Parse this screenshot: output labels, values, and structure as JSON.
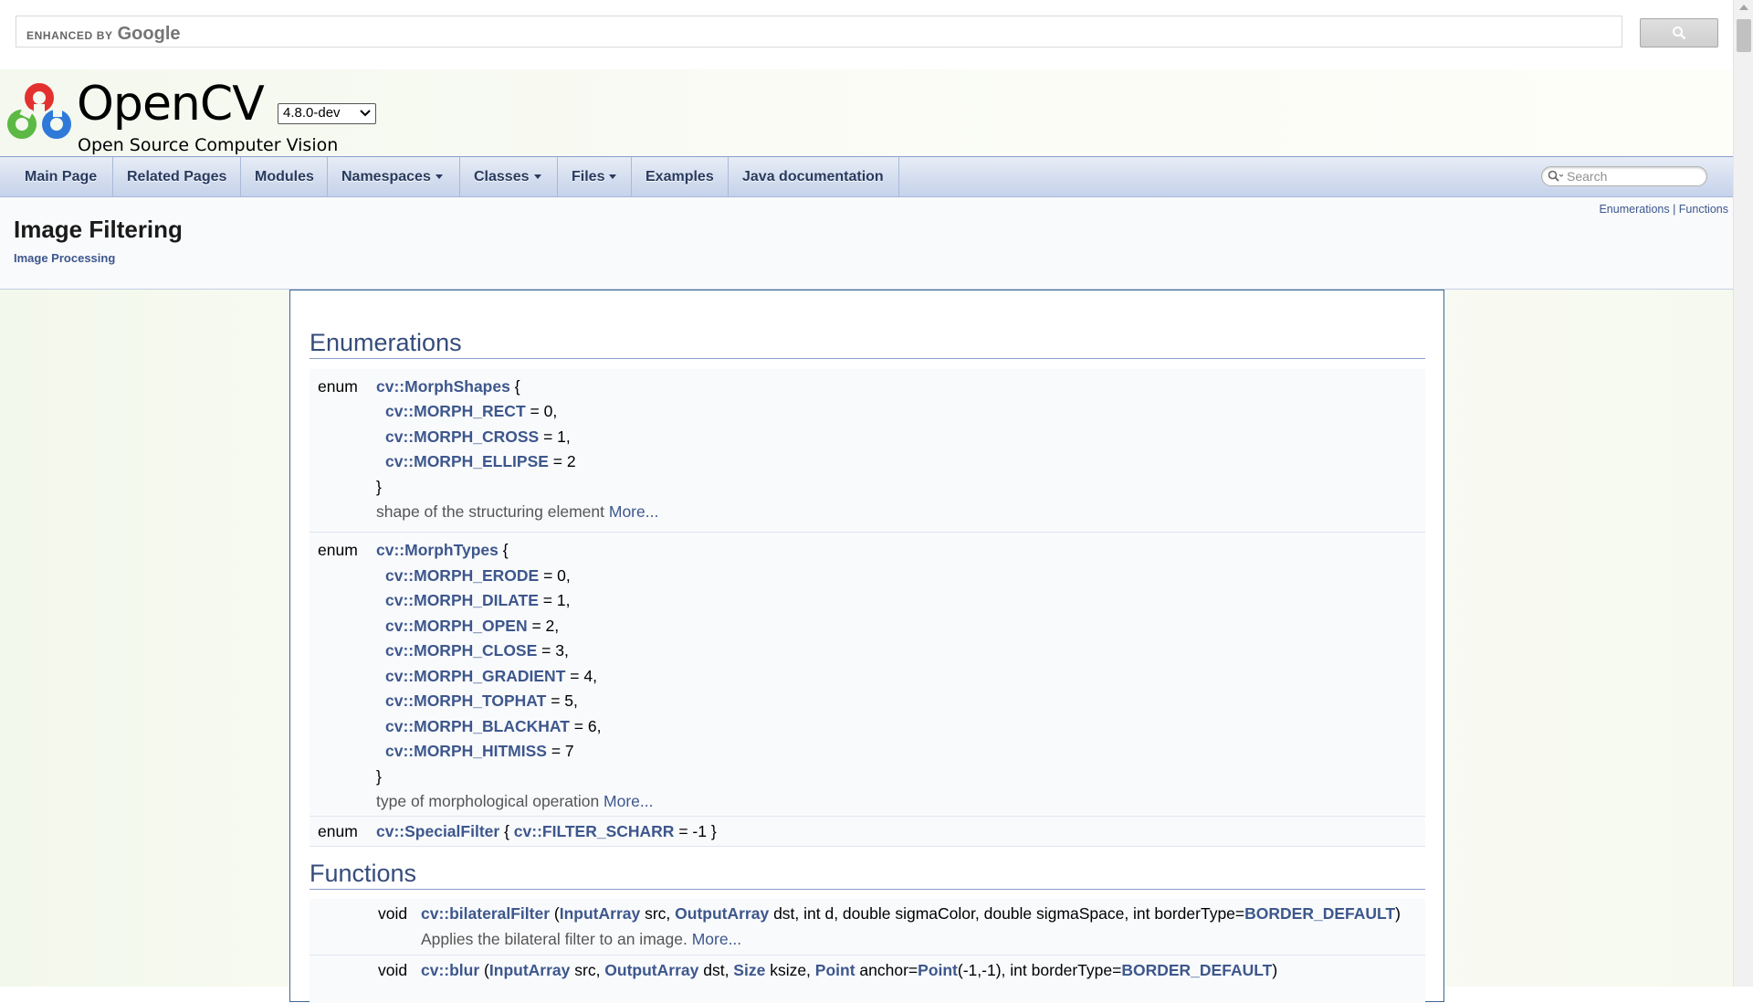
{
  "google_search": {
    "enhanced_by": "ENHANCED BY",
    "google": "Google"
  },
  "header": {
    "project_name": "OpenCV",
    "project_brief": "Open Source Computer Vision",
    "version": "4.8.0-dev"
  },
  "nav": {
    "items": [
      {
        "label": "Main Page",
        "dropdown": false
      },
      {
        "label": "Related Pages",
        "dropdown": false
      },
      {
        "label": "Modules",
        "dropdown": false
      },
      {
        "label": "Namespaces",
        "dropdown": true
      },
      {
        "label": "Classes",
        "dropdown": true
      },
      {
        "label": "Files",
        "dropdown": true
      },
      {
        "label": "Examples",
        "dropdown": false
      },
      {
        "label": "Java documentation",
        "dropdown": false
      }
    ],
    "search_placeholder": "Search"
  },
  "page": {
    "summary": {
      "enumerations": "Enumerations",
      "separator": " | ",
      "functions": "Functions"
    },
    "title": "Image Filtering",
    "ingroup": "Image Processing"
  },
  "sections": {
    "enumerations": "Enumerations",
    "functions": "Functions"
  },
  "enums": [
    {
      "keyword": "enum",
      "name": "cv::MorphShapes",
      "values": [
        {
          "name": "cv::MORPH_RECT",
          "value": " = 0,"
        },
        {
          "name": "cv::MORPH_CROSS",
          "value": " = 1,"
        },
        {
          "name": "cv::MORPH_ELLIPSE",
          "value": " = 2"
        }
      ],
      "description": "shape of the structuring element ",
      "more": "More..."
    },
    {
      "keyword": "enum",
      "name": "cv::MorphTypes",
      "values": [
        {
          "name": "cv::MORPH_ERODE",
          "value": " = 0,"
        },
        {
          "name": "cv::MORPH_DILATE",
          "value": " = 1,"
        },
        {
          "name": "cv::MORPH_OPEN",
          "value": " = 2,"
        },
        {
          "name": "cv::MORPH_CLOSE",
          "value": " = 3,"
        },
        {
          "name": "cv::MORPH_GRADIENT",
          "value": " = 4,"
        },
        {
          "name": "cv::MORPH_TOPHAT",
          "value": " = 5,"
        },
        {
          "name": "cv::MORPH_BLACKHAT",
          "value": " = 6,"
        },
        {
          "name": "cv::MORPH_HITMISS",
          "value": " = 7"
        }
      ],
      "description": "type of morphological operation ",
      "more": "More..."
    },
    {
      "keyword": "enum",
      "name": "cv::SpecialFilter",
      "inline_open": " { ",
      "value_name": "cv::FILTER_SCHARR",
      "inline_close": " = -1 }"
    }
  ],
  "functions": [
    {
      "return_type": "void",
      "name": "cv::bilateralFilter",
      "p1": " (",
      "t1": "InputArray",
      "p2": " src, ",
      "t2": "OutputArray",
      "p3": " dst, int d, double sigmaColor, double sigmaSpace, int borderType=",
      "t3": "BORDER_DEFAULT",
      "p4": ")",
      "description": "Applies the bilateral filter to an image. ",
      "more": "More..."
    },
    {
      "return_type": "void",
      "name": "cv::blur",
      "p1": " (",
      "t1": "InputArray",
      "p2": " src, ",
      "t2": "OutputArray",
      "p3": " dst, ",
      "t3": "Size",
      "p4": " ksize, ",
      "t4": "Point",
      "p5": " anchor=",
      "t5": "Point",
      "p6": "(-1,-1), int borderType=",
      "t6": "BORDER_DEFAULT",
      "p7": ")"
    }
  ],
  "colors": {
    "link": "#3d578c",
    "section_title": "#354c7b",
    "nav_text": "#283a5d",
    "border": "#3b6790"
  }
}
